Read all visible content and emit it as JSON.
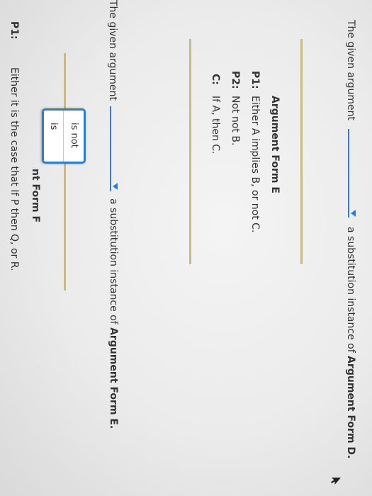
{
  "question1": {
    "prefix": "The given argument",
    "suffix": "a substitution instance of",
    "form_ref": "Argument Form D."
  },
  "argument_form_e": {
    "title": "Argument Form E",
    "premises": [
      {
        "label": "P1:",
        "text": "Either A implies B, or not C."
      },
      {
        "label": "P2:",
        "text": "Not not B."
      },
      {
        "label": "C:",
        "text": "If A, then C."
      }
    ]
  },
  "question2": {
    "prefix": "The given argument",
    "suffix": "a substitution instance of",
    "form_ref": "Argument Form E."
  },
  "dropdown": {
    "options": [
      "is not",
      "is"
    ]
  },
  "argument_form_f": {
    "title_visible": "nt Form F",
    "premises": [
      {
        "label": "P1:",
        "text": "Either it is the case that If P then Q, or R."
      }
    ]
  },
  "colors": {
    "accent": "#2a7fd4",
    "rule": "#c8b98a",
    "text": "#333333"
  },
  "icons": [
    "chevron-down-icon",
    "cursor-arrow-icon"
  ]
}
